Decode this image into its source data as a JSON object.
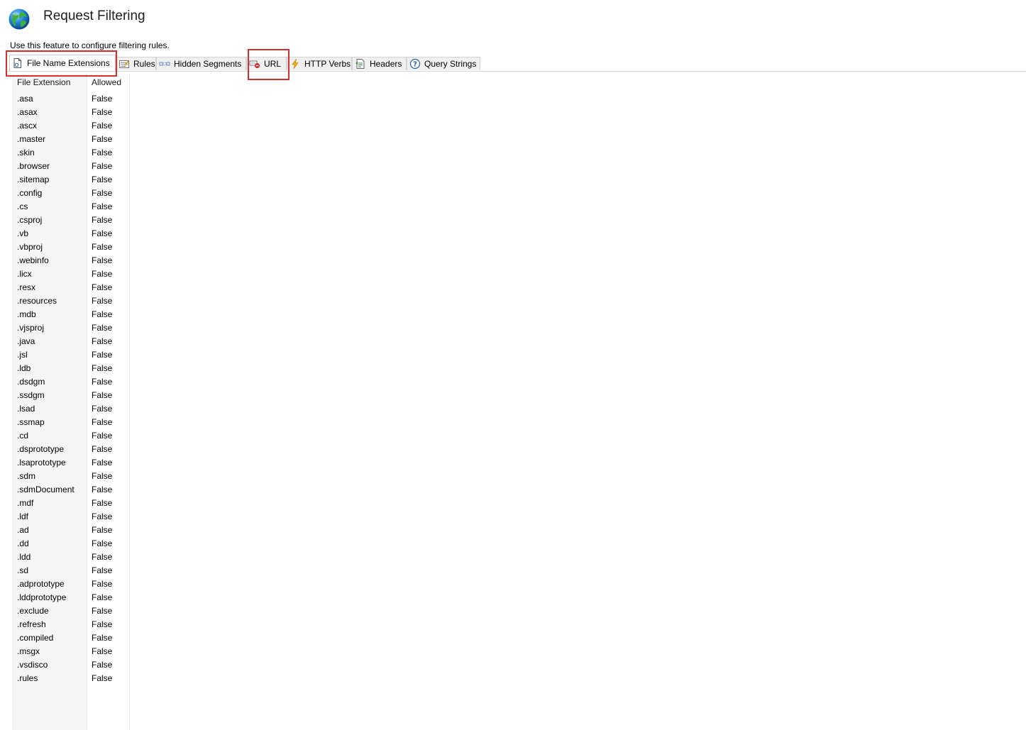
{
  "header": {
    "title": "Request Filtering",
    "description": "Use this feature to configure filtering rules."
  },
  "tabs": [
    {
      "label": "File Name Extensions",
      "icon": "document-gear-icon"
    },
    {
      "label": "Rules",
      "icon": "rules-icon"
    },
    {
      "label": "Hidden Segments",
      "icon": "hidden-segments-icon"
    },
    {
      "label": "URL",
      "icon": "url-deny-icon"
    },
    {
      "label": "HTTP Verbs",
      "icon": "lightning-icon"
    },
    {
      "label": "Headers",
      "icon": "headers-icon"
    },
    {
      "label": "Query Strings",
      "icon": "question-circle-icon"
    }
  ],
  "active_tab": "File Name Extensions",
  "grid": {
    "columns": [
      "File Extension",
      "Allowed"
    ],
    "rows": [
      {
        "ext": ".asa",
        "allowed": "False"
      },
      {
        "ext": ".asax",
        "allowed": "False"
      },
      {
        "ext": ".ascx",
        "allowed": "False"
      },
      {
        "ext": ".master",
        "allowed": "False"
      },
      {
        "ext": ".skin",
        "allowed": "False"
      },
      {
        "ext": ".browser",
        "allowed": "False"
      },
      {
        "ext": ".sitemap",
        "allowed": "False"
      },
      {
        "ext": ".config",
        "allowed": "False"
      },
      {
        "ext": ".cs",
        "allowed": "False"
      },
      {
        "ext": ".csproj",
        "allowed": "False"
      },
      {
        "ext": ".vb",
        "allowed": "False"
      },
      {
        "ext": ".vbproj",
        "allowed": "False"
      },
      {
        "ext": ".webinfo",
        "allowed": "False"
      },
      {
        "ext": ".licx",
        "allowed": "False"
      },
      {
        "ext": ".resx",
        "allowed": "False"
      },
      {
        "ext": ".resources",
        "allowed": "False"
      },
      {
        "ext": ".mdb",
        "allowed": "False"
      },
      {
        "ext": ".vjsproj",
        "allowed": "False"
      },
      {
        "ext": ".java",
        "allowed": "False"
      },
      {
        "ext": ".jsl",
        "allowed": "False"
      },
      {
        "ext": ".ldb",
        "allowed": "False"
      },
      {
        "ext": ".dsdgm",
        "allowed": "False"
      },
      {
        "ext": ".ssdgm",
        "allowed": "False"
      },
      {
        "ext": ".lsad",
        "allowed": "False"
      },
      {
        "ext": ".ssmap",
        "allowed": "False"
      },
      {
        "ext": ".cd",
        "allowed": "False"
      },
      {
        "ext": ".dsprototype",
        "allowed": "False"
      },
      {
        "ext": ".lsaprototype",
        "allowed": "False"
      },
      {
        "ext": ".sdm",
        "allowed": "False"
      },
      {
        "ext": ".sdmDocument",
        "allowed": "False"
      },
      {
        "ext": ".mdf",
        "allowed": "False"
      },
      {
        "ext": ".ldf",
        "allowed": "False"
      },
      {
        "ext": ".ad",
        "allowed": "False"
      },
      {
        "ext": ".dd",
        "allowed": "False"
      },
      {
        "ext": ".ldd",
        "allowed": "False"
      },
      {
        "ext": ".sd",
        "allowed": "False"
      },
      {
        "ext": ".adprototype",
        "allowed": "False"
      },
      {
        "ext": ".lddprototype",
        "allowed": "False"
      },
      {
        "ext": ".exclude",
        "allowed": "False"
      },
      {
        "ext": ".refresh",
        "allowed": "False"
      },
      {
        "ext": ".compiled",
        "allowed": "False"
      },
      {
        "ext": ".msgx",
        "allowed": "False"
      },
      {
        "ext": ".vsdisco",
        "allowed": "False"
      },
      {
        "ext": ".rules",
        "allowed": "False"
      }
    ]
  },
  "colors": {
    "annotation_border": "#d32f2f",
    "tab_background": "#f0f0f0",
    "extension_column_background": "#f5f5f5"
  }
}
